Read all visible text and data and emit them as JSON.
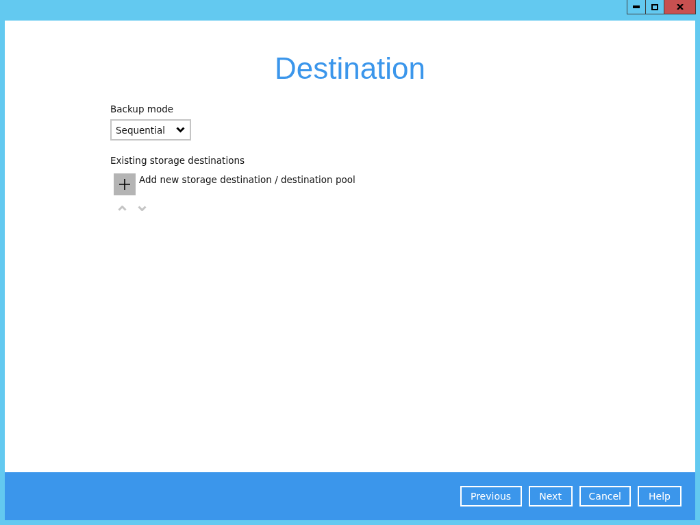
{
  "title": "Destination",
  "backup_mode": {
    "label": "Backup mode",
    "value": "Sequential"
  },
  "storage": {
    "label": "Existing storage destinations",
    "add_label": "Add new storage destination / destination pool",
    "move_up_disabled": true,
    "move_down_disabled": true
  },
  "buttons": [
    "Previous",
    "Next",
    "Cancel",
    "Help"
  ]
}
